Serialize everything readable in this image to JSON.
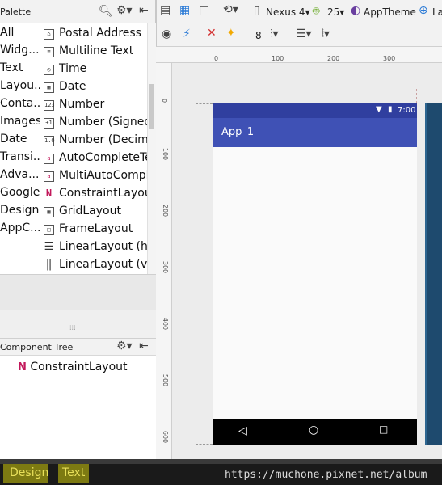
{
  "palette": {
    "title": "Palette",
    "categories": [
      "All",
      "Widg...",
      "Text",
      "Layou...",
      "Conta...",
      "Images",
      "Date",
      "Transi...",
      "Adva...",
      "Google",
      "Design",
      "AppC..."
    ],
    "items": [
      {
        "icon": "home-icon",
        "glyph": "⌂",
        "label": "Postal Address"
      },
      {
        "icon": "multiline-icon",
        "glyph": "≡",
        "label": "Multiline Text"
      },
      {
        "icon": "clock-icon",
        "glyph": "◷",
        "label": "Time"
      },
      {
        "icon": "calendar-icon",
        "glyph": "▦",
        "label": "Date"
      },
      {
        "icon": "number-icon",
        "glyph": "123",
        "label": "Number"
      },
      {
        "icon": "signed-number-icon",
        "glyph": "±1",
        "label": "Number (Signed)"
      },
      {
        "icon": "decimal-number-icon",
        "glyph": "1.0",
        "label": "Number (Decimal)"
      },
      {
        "icon": "autocomplete-icon",
        "glyph": "a",
        "label": "AutoCompleteTextView"
      },
      {
        "icon": "multiauto-icon",
        "glyph": "a",
        "label": "MultiAutoCompleteTextView"
      },
      {
        "icon": "constraint-layout-icon",
        "glyph": "N",
        "label": "ConstraintLayout"
      },
      {
        "icon": "grid-layout-icon",
        "glyph": "▦",
        "label": "GridLayout"
      },
      {
        "icon": "frame-layout-icon",
        "glyph": "□",
        "label": "FrameLayout"
      },
      {
        "icon": "linear-layout-h-icon",
        "glyph": "☰",
        "label": "LinearLayout (horizontal)"
      },
      {
        "icon": "linear-layout-v-icon",
        "glyph": "‖",
        "label": "LinearLayout (vertical)"
      }
    ]
  },
  "toolbar": {
    "device": "Nexus 4",
    "api": "25",
    "theme": "AppTheme",
    "locale": "La",
    "margin": "8"
  },
  "rulers": {
    "top": [
      "0",
      "100",
      "200",
      "300"
    ],
    "left": [
      "0",
      "100",
      "200",
      "300",
      "400",
      "500",
      "600"
    ]
  },
  "component_tree": {
    "title": "Component Tree",
    "root": "ConstraintLayout"
  },
  "device_preview": {
    "status_time": "7:00",
    "app_title": "App_1"
  },
  "bottom_tabs": {
    "design": "Design",
    "text": "Text"
  },
  "watermark": "https://muchone.pixnet.net/album",
  "colors": {
    "primary": "#3f51b5",
    "primary_dark": "#303f9f",
    "tab_highlight": "#7d7a12"
  }
}
